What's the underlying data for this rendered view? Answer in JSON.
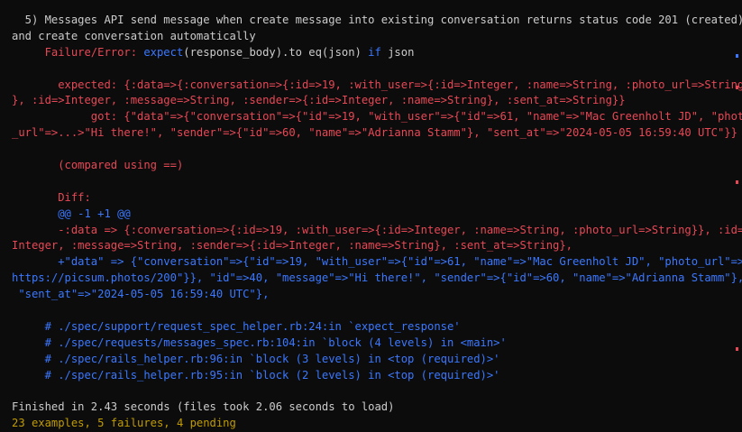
{
  "lines": {
    "l1": "  5) Messages API send message when create message into existing conversation returns status code 201 (created)",
    "l2": "and create conversation automatically",
    "l3a": "     Failure/Error: ",
    "l3b": "expect",
    "l3c": "(response_body).to eq(json) ",
    "l3d": "if",
    "l3e": " json",
    "l4": "       expected: {:data=>{:conversation=>{:id=>19, :with_user=>{:id=>Integer, :name=>String, :photo_url=>String}",
    "l5": "}, :id=>Integer, :message=>String, :sender=>{:id=>Integer, :name=>String}, :sent_at=>String}}",
    "l6": "            got: {\"data\"=>{\"conversation\"=>{\"id\"=>19, \"with_user\"=>{\"id\"=>61, \"name\"=>\"Mac Greenholt JD\", \"photo",
    "l7": "_url\"=>...>\"Hi there!\", \"sender\"=>{\"id\"=>60, \"name\"=>\"Adrianna Stamm\"}, \"sent_at\"=>\"2024-05-05 16:59:40 UTC\"}}",
    "l8": "       (compared using ==)",
    "l9": "       Diff:",
    "l10": "       @@ -1 +1 @@",
    "l11": "       -:data => {:conversation=>{:id=>19, :with_user=>{:id=>Integer, :name=>String, :photo_url=>String}}, :id=>",
    "l12": "Integer, :message=>String, :sender=>{:id=>Integer, :name=>String}, :sent_at=>String},",
    "l13": "       +\"data\" => {\"conversation\"=>{\"id\"=>19, \"with_user\"=>{\"id\"=>61, \"name\"=>\"Mac Greenholt JD\", \"photo_url\"=>\"",
    "l14": "https://picsum.photos/200\"}}, \"id\"=>40, \"message\"=>\"Hi there!\", \"sender\"=>{\"id\"=>60, \"name\"=>\"Adrianna Stamm\"},",
    "l15": " \"sent_at\"=>\"2024-05-05 16:59:40 UTC\"},",
    "l16": "     # ./spec/support/request_spec_helper.rb:24:in `expect_response'",
    "l17": "     # ./spec/requests/messages_spec.rb:104:in `block (4 levels) in <main>'",
    "l18": "     # ./spec/rails_helper.rb:96:in `block (3 levels) in <top (required)>'",
    "l19": "     # ./spec/rails_helper.rb:95:in `block (2 levels) in <top (required)>'",
    "l20": "Finished in 2.43 seconds (files took 2.06 seconds to load)",
    "l21": "23 examples, 5 failures, 4 pending"
  },
  "colors": {
    "background": "#0c0c0c",
    "foreground": "#cccccc",
    "error": "#e74856",
    "warning": "#c19c00",
    "keyword": "#3b78ff",
    "summary": "#c19c00"
  }
}
